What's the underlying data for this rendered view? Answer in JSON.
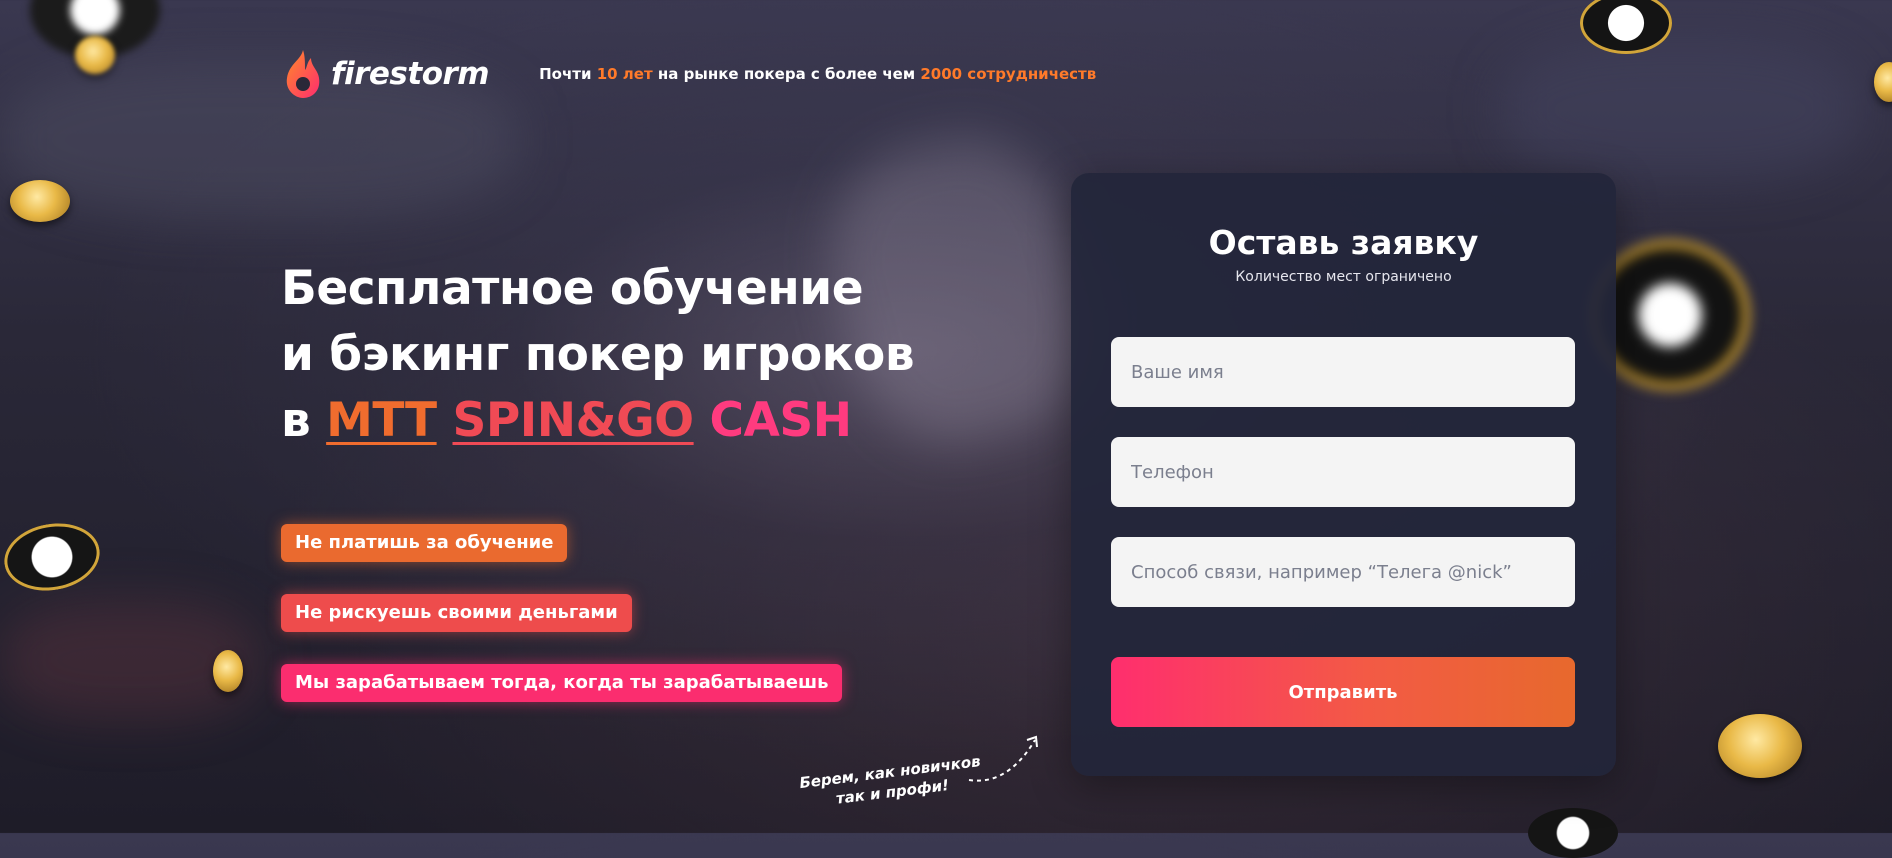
{
  "brand": {
    "name": "firestorm",
    "logo_icon": "flame-icon",
    "accent_color": "#ff7a2a"
  },
  "tagline": {
    "part1": "Почти ",
    "years": "10 лет",
    "part2": " на рынке покера с более чем ",
    "count": "2000 сотрудничеств"
  },
  "hero": {
    "line1": "Бесплатное обучение",
    "line2": "и бэкинг покер игроков",
    "line3_prefix": "в",
    "tags": [
      "MTT",
      "SPIN&GO",
      "CASH"
    ]
  },
  "benefits": [
    "Не платишь за обучение",
    "Не рискуешь своими деньгами",
    "Мы зарабатываем тогда, когда ты зарабатываешь"
  ],
  "note": {
    "line1": "Берем, как новичков",
    "line2": "так и профи!"
  },
  "form": {
    "title": "Оставь заявку",
    "subtitle": "Количество мест ограничено",
    "name_placeholder": "Ваше имя",
    "phone_placeholder": "Телефон",
    "contact_placeholder": "Способ связи, например “Телега @nick”",
    "submit_label": "Отправить"
  }
}
